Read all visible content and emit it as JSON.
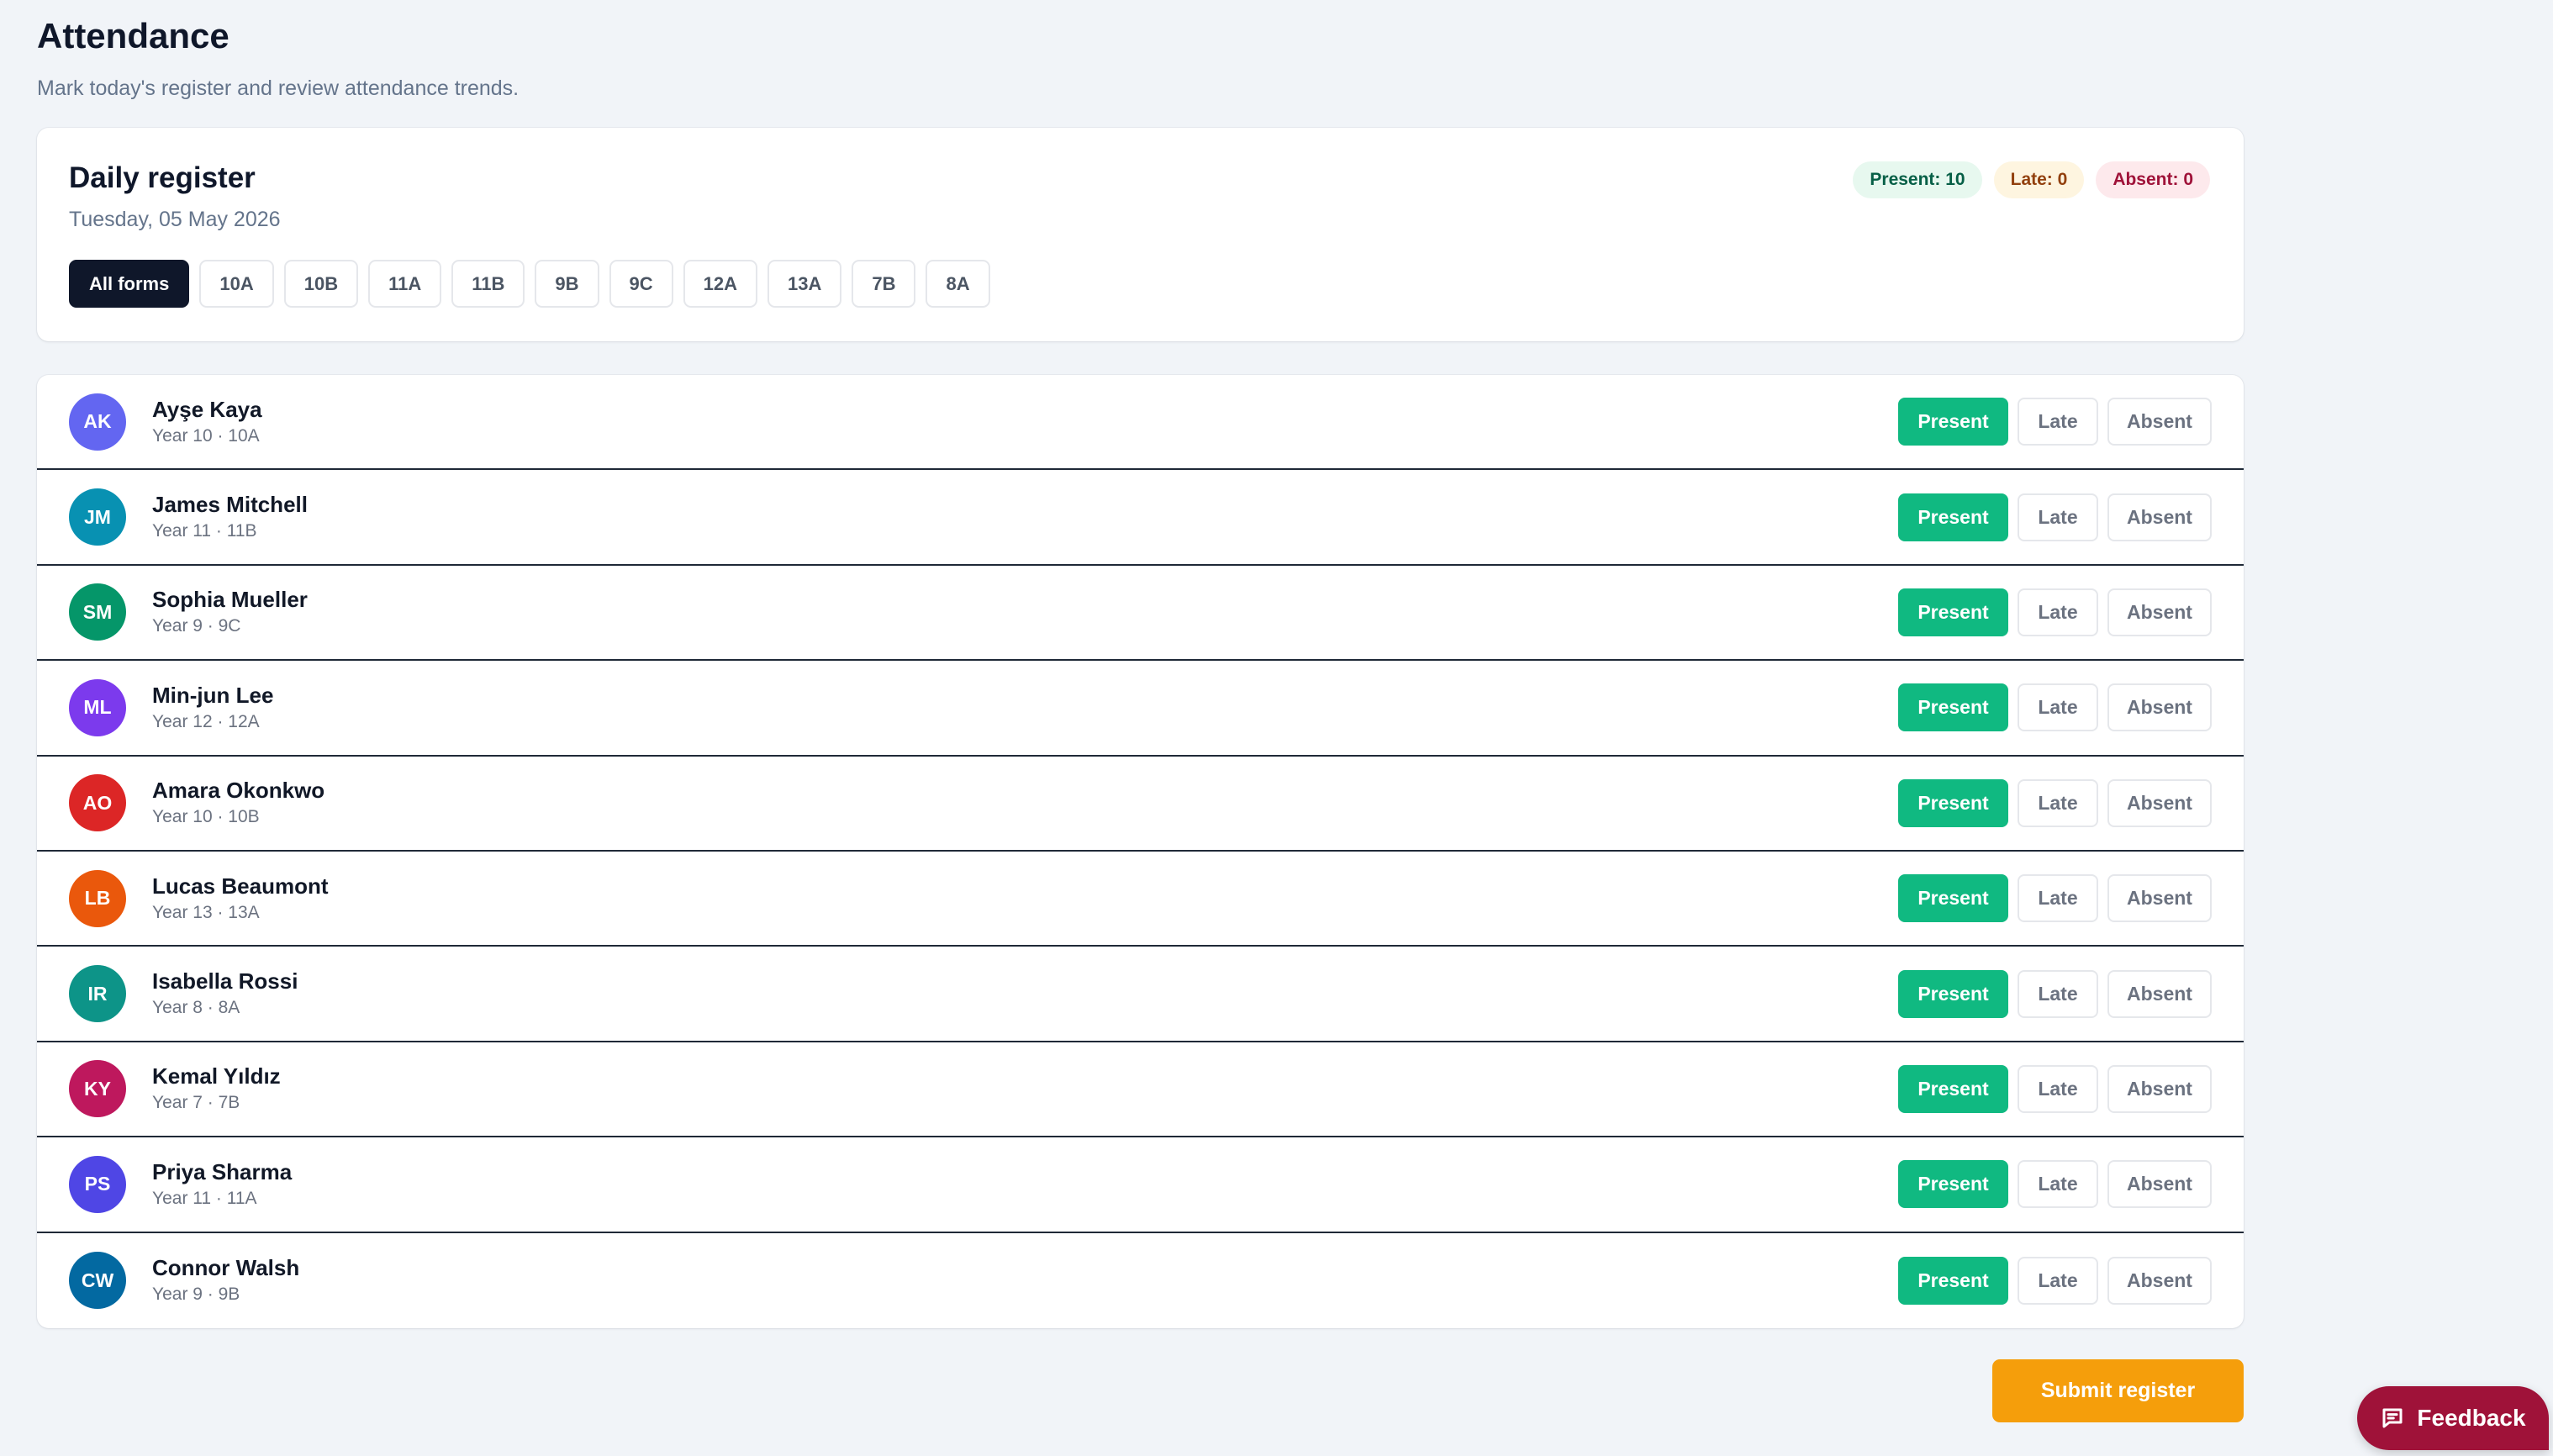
{
  "header": {
    "title": "Attendance",
    "subtitle": "Mark today's register and review attendance trends."
  },
  "register": {
    "title": "Daily register",
    "date": "Tuesday, 05 May 2026",
    "summary": {
      "present": "Present: 10",
      "late": "Late: 0",
      "absent": "Absent: 0"
    },
    "filters": [
      "All forms",
      "10A",
      "10B",
      "11A",
      "11B",
      "9B",
      "9C",
      "12A",
      "13A",
      "7B",
      "8A"
    ],
    "active_filter": "All forms"
  },
  "students": [
    {
      "initials": "AK",
      "name": "Ayşe Kaya",
      "meta": "Year 10 · 10A",
      "color": "#6366f1",
      "status": "Present"
    },
    {
      "initials": "JM",
      "name": "James Mitchell",
      "meta": "Year 11 · 11B",
      "color": "#0891b2",
      "status": "Present"
    },
    {
      "initials": "SM",
      "name": "Sophia Mueller",
      "meta": "Year 9 · 9C",
      "color": "#059669",
      "status": "Present"
    },
    {
      "initials": "ML",
      "name": "Min-jun Lee",
      "meta": "Year 12 · 12A",
      "color": "#7c3aed",
      "status": "Present"
    },
    {
      "initials": "AO",
      "name": "Amara Okonkwo",
      "meta": "Year 10 · 10B",
      "color": "#dc2626",
      "status": "Present"
    },
    {
      "initials": "LB",
      "name": "Lucas Beaumont",
      "meta": "Year 13 · 13A",
      "color": "#ea580c",
      "status": "Present"
    },
    {
      "initials": "IR",
      "name": "Isabella Rossi",
      "meta": "Year 8 · 8A",
      "color": "#0d9488",
      "status": "Present"
    },
    {
      "initials": "KY",
      "name": "Kemal Yıldız",
      "meta": "Year 7 · 7B",
      "color": "#be185d",
      "status": "Present"
    },
    {
      "initials": "PS",
      "name": "Priya Sharma",
      "meta": "Year 11 · 11A",
      "color": "#4f46e5",
      "status": "Present"
    },
    {
      "initials": "CW",
      "name": "Connor Walsh",
      "meta": "Year 9 · 9B",
      "color": "#0369a1",
      "status": "Present"
    }
  ],
  "status_labels": {
    "present": "Present",
    "late": "Late",
    "absent": "Absent"
  },
  "colors": {
    "present": "#10b981",
    "submit": "#f59e0b",
    "feedback": "#9f1239",
    "active_chip": "#0f172a"
  },
  "submit_label": "Submit register",
  "feedback": {
    "label": "Feedback",
    "icon": "chat-icon"
  }
}
